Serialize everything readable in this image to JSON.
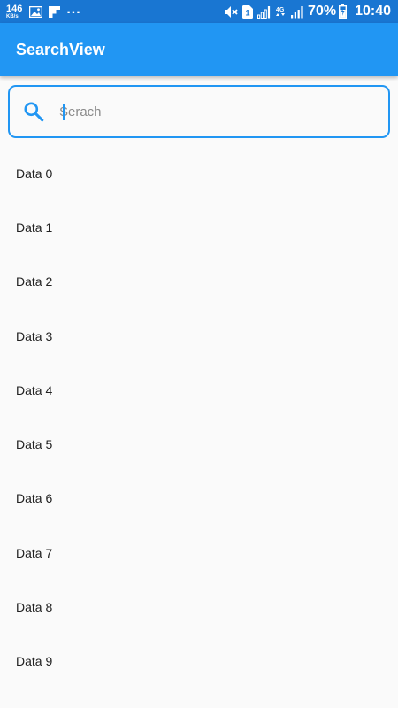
{
  "status_bar": {
    "speed_value": "146",
    "speed_unit": "KB/s",
    "overflow": "...",
    "sim_label": "1",
    "network_label": "4G",
    "battery_text": "70%",
    "time": "10:40"
  },
  "app_bar": {
    "title": "SearchView"
  },
  "search": {
    "placeholder": "Serach",
    "value": "",
    "accent_color": "#2196f3"
  },
  "list": {
    "items": [
      {
        "label": "Data 0"
      },
      {
        "label": "Data 1"
      },
      {
        "label": "Data 2"
      },
      {
        "label": "Data 3"
      },
      {
        "label": "Data 4"
      },
      {
        "label": "Data 5"
      },
      {
        "label": "Data 6"
      },
      {
        "label": "Data 7"
      },
      {
        "label": "Data 8"
      },
      {
        "label": "Data 9"
      }
    ]
  },
  "colors": {
    "status_bar": "#1976d2",
    "app_bar": "#2196f3",
    "background": "#fafafa"
  }
}
